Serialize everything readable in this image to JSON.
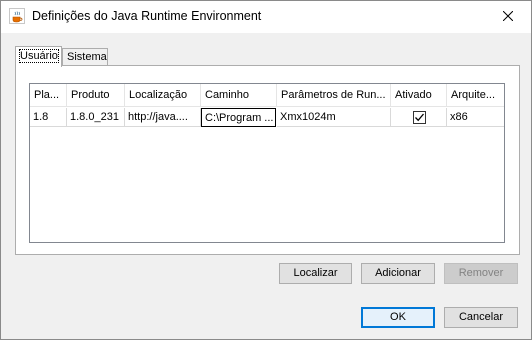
{
  "window": {
    "title": "Definições do Java Runtime Environment",
    "icon": "java-cup-icon",
    "close_icon": "close-icon"
  },
  "tabs": [
    {
      "label": "Usuário",
      "active": true
    },
    {
      "label": "Sistema",
      "active": false
    }
  ],
  "table": {
    "columns": [
      "Pla...",
      "Produto",
      "Localização",
      "Caminho",
      "Parâmetros de Run...",
      "Ativado",
      "Arquite..."
    ],
    "rows": [
      {
        "platform": "1.8",
        "product": "1.8.0_231",
        "location": "http://java....",
        "path": "C:\\Program ...",
        "params": "Xmx1024m",
        "enabled": true,
        "arch": "x86"
      }
    ]
  },
  "buttons": {
    "find": "Localizar",
    "add": "Adicionar",
    "remove": "Remover",
    "ok": "OK",
    "cancel": "Cancelar"
  },
  "colors": {
    "accent": "#0078d7",
    "window_bg": "#f0f0f0"
  }
}
